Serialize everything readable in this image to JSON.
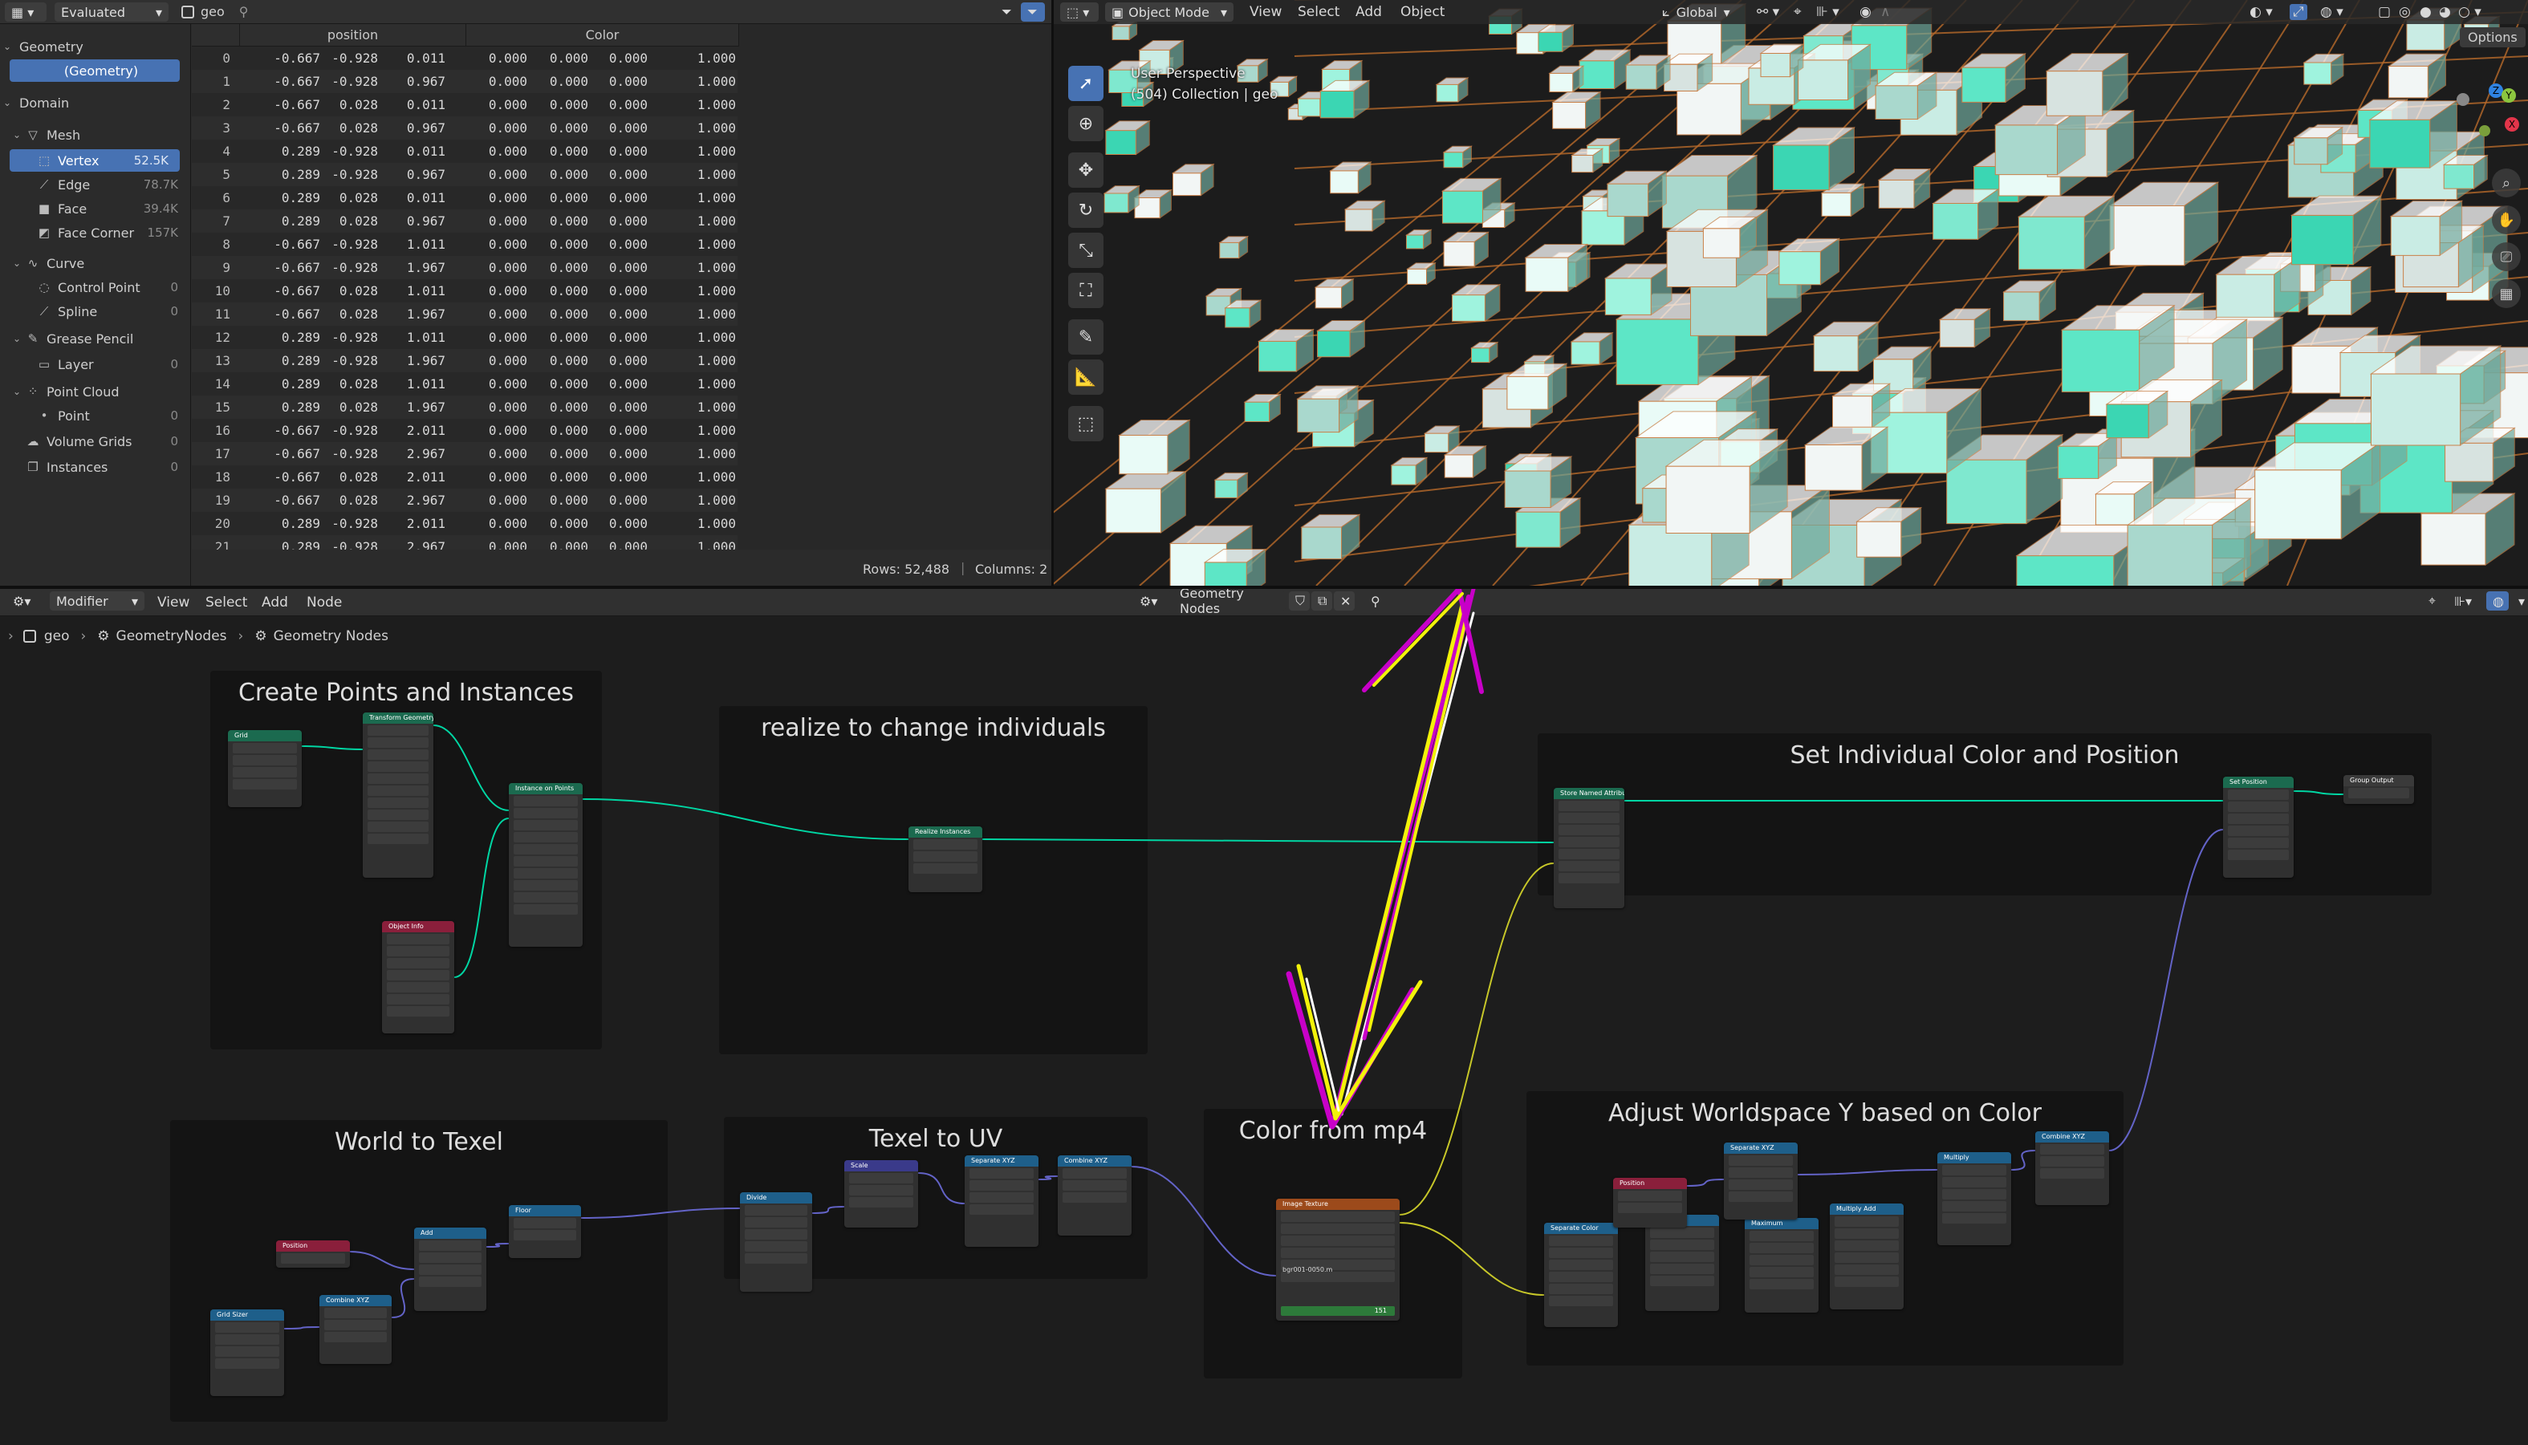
{
  "spreadsheet": {
    "header": {
      "mode": "Evaluated",
      "object": "geo"
    },
    "sidebar": [
      {
        "label": "Geometry",
        "kind": "section",
        "count": ""
      },
      {
        "label": "(Geometry)",
        "kind": "item-selected",
        "count": ""
      },
      {
        "label": "Domain",
        "kind": "section",
        "count": ""
      },
      {
        "label": "Mesh",
        "kind": "group",
        "count": ""
      },
      {
        "label": "Vertex",
        "kind": "item-selected",
        "count": "52.5K"
      },
      {
        "label": "Edge",
        "kind": "item",
        "count": "78.7K"
      },
      {
        "label": "Face",
        "kind": "item",
        "count": "39.4K"
      },
      {
        "label": "Face Corner",
        "kind": "item",
        "count": "157K"
      },
      {
        "label": "Curve",
        "kind": "group",
        "count": ""
      },
      {
        "label": "Control Point",
        "kind": "item",
        "count": "0"
      },
      {
        "label": "Spline",
        "kind": "item",
        "count": "0"
      },
      {
        "label": "Grease Pencil",
        "kind": "group",
        "count": ""
      },
      {
        "label": "Layer",
        "kind": "item",
        "count": "0"
      },
      {
        "label": "Point Cloud",
        "kind": "group",
        "count": ""
      },
      {
        "label": "Point",
        "kind": "item",
        "count": "0"
      },
      {
        "label": "Volume Grids",
        "kind": "group-noarrow",
        "count": "0"
      },
      {
        "label": "Instances",
        "kind": "group-noarrow",
        "count": "0"
      }
    ],
    "columns": [
      "position",
      "Color"
    ],
    "rows": [
      [
        "0",
        "-0.667",
        "-0.928",
        "0.011",
        "0.000",
        "0.000",
        "0.000",
        "1.000"
      ],
      [
        "1",
        "-0.667",
        "-0.928",
        "0.967",
        "0.000",
        "0.000",
        "0.000",
        "1.000"
      ],
      [
        "2",
        "-0.667",
        "0.028",
        "0.011",
        "0.000",
        "0.000",
        "0.000",
        "1.000"
      ],
      [
        "3",
        "-0.667",
        "0.028",
        "0.967",
        "0.000",
        "0.000",
        "0.000",
        "1.000"
      ],
      [
        "4",
        "0.289",
        "-0.928",
        "0.011",
        "0.000",
        "0.000",
        "0.000",
        "1.000"
      ],
      [
        "5",
        "0.289",
        "-0.928",
        "0.967",
        "0.000",
        "0.000",
        "0.000",
        "1.000"
      ],
      [
        "6",
        "0.289",
        "0.028",
        "0.011",
        "0.000",
        "0.000",
        "0.000",
        "1.000"
      ],
      [
        "7",
        "0.289",
        "0.028",
        "0.967",
        "0.000",
        "0.000",
        "0.000",
        "1.000"
      ],
      [
        "8",
        "-0.667",
        "-0.928",
        "1.011",
        "0.000",
        "0.000",
        "0.000",
        "1.000"
      ],
      [
        "9",
        "-0.667",
        "-0.928",
        "1.967",
        "0.000",
        "0.000",
        "0.000",
        "1.000"
      ],
      [
        "10",
        "-0.667",
        "0.028",
        "1.011",
        "0.000",
        "0.000",
        "0.000",
        "1.000"
      ],
      [
        "11",
        "-0.667",
        "0.028",
        "1.967",
        "0.000",
        "0.000",
        "0.000",
        "1.000"
      ],
      [
        "12",
        "0.289",
        "-0.928",
        "1.011",
        "0.000",
        "0.000",
        "0.000",
        "1.000"
      ],
      [
        "13",
        "0.289",
        "-0.928",
        "1.967",
        "0.000",
        "0.000",
        "0.000",
        "1.000"
      ],
      [
        "14",
        "0.289",
        "0.028",
        "1.011",
        "0.000",
        "0.000",
        "0.000",
        "1.000"
      ],
      [
        "15",
        "0.289",
        "0.028",
        "1.967",
        "0.000",
        "0.000",
        "0.000",
        "1.000"
      ],
      [
        "16",
        "-0.667",
        "-0.928",
        "2.011",
        "0.000",
        "0.000",
        "0.000",
        "1.000"
      ],
      [
        "17",
        "-0.667",
        "-0.928",
        "2.967",
        "0.000",
        "0.000",
        "0.000",
        "1.000"
      ],
      [
        "18",
        "-0.667",
        "0.028",
        "2.011",
        "0.000",
        "0.000",
        "0.000",
        "1.000"
      ],
      [
        "19",
        "-0.667",
        "0.028",
        "2.967",
        "0.000",
        "0.000",
        "0.000",
        "1.000"
      ],
      [
        "20",
        "0.289",
        "-0.928",
        "2.011",
        "0.000",
        "0.000",
        "0.000",
        "1.000"
      ],
      [
        "21",
        "0.289",
        "-0.928",
        "2.967",
        "0.000",
        "0.000",
        "0.000",
        "1.000"
      ]
    ],
    "status": {
      "rows": "Rows: 52,488",
      "columns": "Columns: 2"
    }
  },
  "viewport": {
    "mode": "Object Mode",
    "menus": [
      "View",
      "Select",
      "Add",
      "Object"
    ],
    "orientation": "Global",
    "overlay_text_1": "User Perspective",
    "overlay_text_2": "(504) Collection | geo",
    "options_label": "Options",
    "gizmo": {
      "z": "Z",
      "y": "Y",
      "x": "X"
    }
  },
  "node_editor": {
    "header": {
      "context": "Modifier",
      "menus": [
        "View",
        "Select",
        "Add",
        "Node"
      ],
      "tree_name": "Geometry Nodes"
    },
    "breadcrumb": [
      "geo",
      "GeometryNodes",
      "Geometry Nodes"
    ],
    "frames": [
      "Create Points and Instances",
      "realize to change individuals",
      "Set Individual Color and Position",
      "World to Texel",
      "Texel to UV",
      "Color from mp4",
      "Adjust Worldspace Y based on Color"
    ],
    "nodes": [
      "Grid",
      "Transform Geometry",
      "Object Info",
      "Instance on Points",
      "Realize Instances",
      "Store Named Attribute",
      "Set Position",
      "Group Output",
      "Position",
      "Add",
      "Floor",
      "Grid Sizer",
      "Combine XYZ",
      "Divide",
      "Scale",
      "Separate XYZ",
      "Combine XYZ",
      "Image Texture",
      "Separate Color",
      "Maximum",
      "Maximum",
      "Separate XYZ",
      "Multiply",
      "Multiply Add",
      "Combine XYZ",
      "Position"
    ],
    "media_label": "bgr001-0050.m",
    "frame_value": "151"
  },
  "colors": {
    "accent": "#4772b3",
    "geometry_link": "#00d6a3",
    "vector_link": "#6363c7",
    "color_link": "#c7c729",
    "annotation_yellow": "#f2f20a",
    "annotation_magenta": "#c800c8",
    "annotation_white": "#ffffff"
  }
}
